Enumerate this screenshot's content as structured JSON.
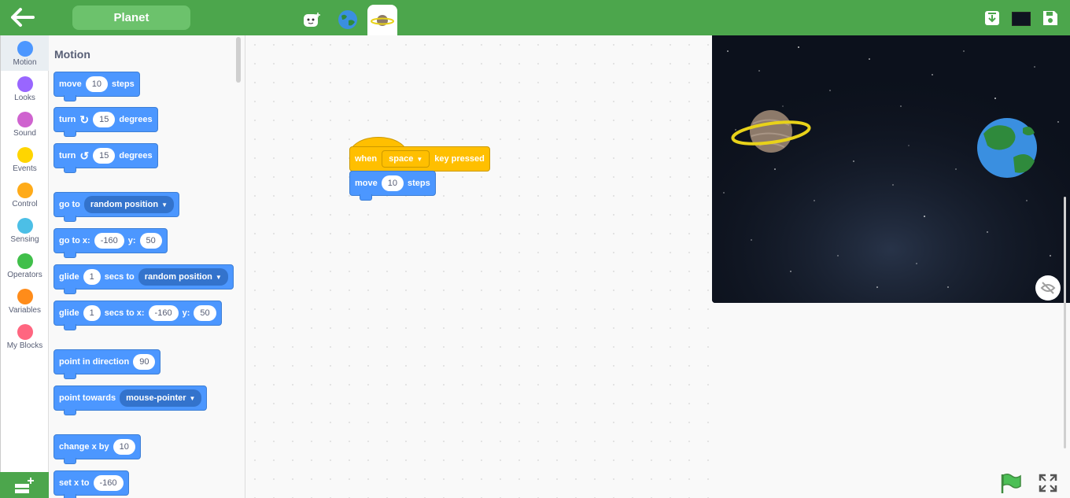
{
  "header": {
    "project_title": "Planet",
    "sprites": [
      "robot-sprite-icon",
      "earth-sprite-icon",
      "planet-sprite-icon"
    ],
    "colors": {
      "bar": "#4ca64c",
      "title_pill": "#6cc26c"
    }
  },
  "categories": [
    {
      "label": "Motion",
      "color": "#4c97ff"
    },
    {
      "label": "Looks",
      "color": "#9966ff"
    },
    {
      "label": "Sound",
      "color": "#cf63cf"
    },
    {
      "label": "Events",
      "color": "#ffd500"
    },
    {
      "label": "Control",
      "color": "#ffab19"
    },
    {
      "label": "Sensing",
      "color": "#4cbfe6"
    },
    {
      "label": "Operators",
      "color": "#40bf4a"
    },
    {
      "label": "Variables",
      "color": "#ff8c1a"
    },
    {
      "label": "My Blocks",
      "color": "#ff6680"
    }
  ],
  "palette": {
    "title": "Motion",
    "move": {
      "a": "move",
      "v": "10",
      "b": "steps"
    },
    "turn_cw": {
      "a": "turn",
      "v": "15",
      "b": "degrees"
    },
    "turn_ccw": {
      "a": "turn",
      "v": "15",
      "b": "degrees"
    },
    "goto": {
      "a": "go to",
      "d": "random position"
    },
    "goto_xy": {
      "a": "go to x:",
      "x": "-160",
      "b": "y:",
      "y": "50"
    },
    "glide": {
      "a": "glide",
      "v": "1",
      "b": "secs to",
      "d": "random position"
    },
    "glide_xy": {
      "a": "glide",
      "v": "1",
      "b": "secs to x:",
      "x": "-160",
      "c": "y:",
      "y": "50"
    },
    "point_dir": {
      "a": "point in direction",
      "v": "90"
    },
    "point_towards": {
      "a": "point towards",
      "d": "mouse-pointer"
    },
    "change_x": {
      "a": "change x by",
      "v": "10"
    },
    "set_x": {
      "a": "set x to",
      "v": "-160"
    }
  },
  "script": {
    "event": {
      "a": "when",
      "key": "space",
      "b": "key pressed"
    },
    "move": {
      "a": "move",
      "v": "10",
      "b": "steps"
    }
  }
}
